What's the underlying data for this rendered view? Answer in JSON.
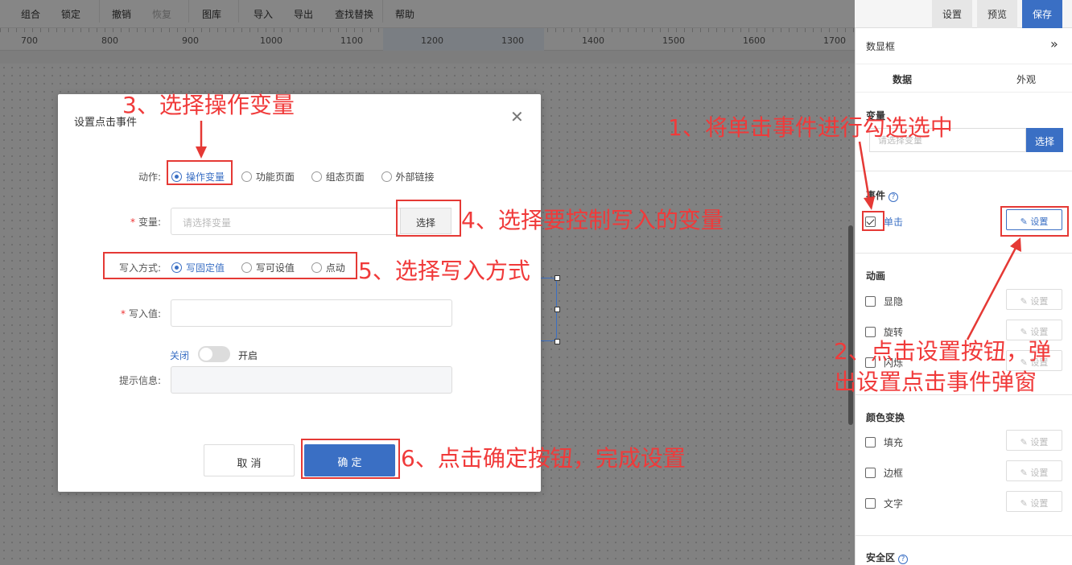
{
  "toolbar": {
    "items": [
      "组合",
      "锁定",
      "撤销",
      "恢复",
      "图库",
      "导入",
      "导出",
      "查找替换",
      "帮助"
    ],
    "right": [
      "设置",
      "预览",
      "保存"
    ]
  },
  "ruler": {
    "labels": [
      "700",
      "800",
      "900",
      "1000",
      "1100",
      "1200",
      "1300",
      "1400",
      "1500",
      "1600",
      "1700"
    ]
  },
  "panel": {
    "title": "数显框",
    "tabs": [
      "数据",
      "外观"
    ],
    "variable_section": "变量",
    "variable_placeholder": "请选择变量",
    "choose_label": "选择",
    "event_section": "事件",
    "event_click": "单击",
    "set_label": "设置",
    "animation_section": "动画",
    "animations": [
      "显隐",
      "旋转",
      "闪烁"
    ],
    "color_section": "颜色变换",
    "colors": [
      "填充",
      "边框",
      "文字"
    ],
    "safe_section": "安全区",
    "help": "?"
  },
  "dialog": {
    "title": "设置点击事件",
    "action_label": "动作:",
    "actions": [
      "操作变量",
      "功能页面",
      "组态页面",
      "外部链接"
    ],
    "variable_label": "变量:",
    "variable_placeholder": "请选择变量",
    "choose_label": "选择",
    "write_mode_label": "写入方式:",
    "write_modes": [
      "写固定值",
      "写可设值",
      "点动"
    ],
    "write_value_label": "写入值:",
    "toggle_off": "关闭",
    "toggle_on": "开启",
    "tip_label": "提示信息:",
    "cancel_label": "取 消",
    "ok_label": "确 定",
    "required_mark": "*"
  },
  "annotations": {
    "step1": "1、将单击事件进行勾选选中",
    "step2_line1": "2、点击设置按钮，弹",
    "step2_line2": "出设置点击事件弹窗",
    "step3": "3、选择操作变量",
    "step4": "4、选择要控制写入的变量",
    "step5": "5、选择写入方式",
    "step6": "6、点击确定按钮，完成设置",
    "color": "#f03a3a"
  }
}
